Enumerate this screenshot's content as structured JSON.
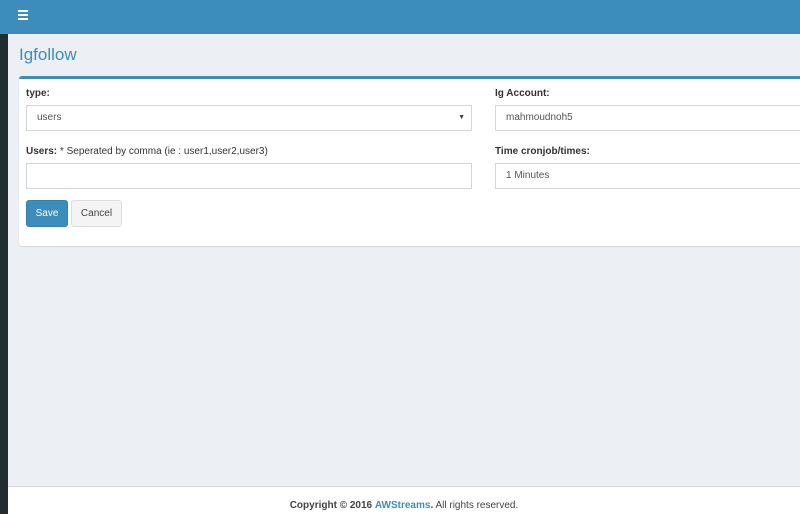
{
  "header": {
    "menu_icon": "hamburger-menu-icon"
  },
  "page": {
    "title": "Igfollow"
  },
  "form": {
    "type_label": "type:",
    "type_value": "users",
    "users_label": "Users:",
    "users_hint": "* Seperated by comma (ie : user1,user2,user3)",
    "users_value": "",
    "account_label": "Ig Account:",
    "account_value": "mahmoudnoh5",
    "cron_label": "Time cronjob/times:",
    "cron_value": "1 Minutes",
    "save_label": "Save",
    "cancel_label": "Cancel"
  },
  "footer": {
    "copyright": "Copyright © 2016",
    "brand": "AWStreams",
    "dot": ".",
    "rights": "All rights reserved."
  },
  "colors": {
    "accent": "#3c8dbc",
    "sidebar": "#222d32",
    "background": "#ecf0f5"
  }
}
